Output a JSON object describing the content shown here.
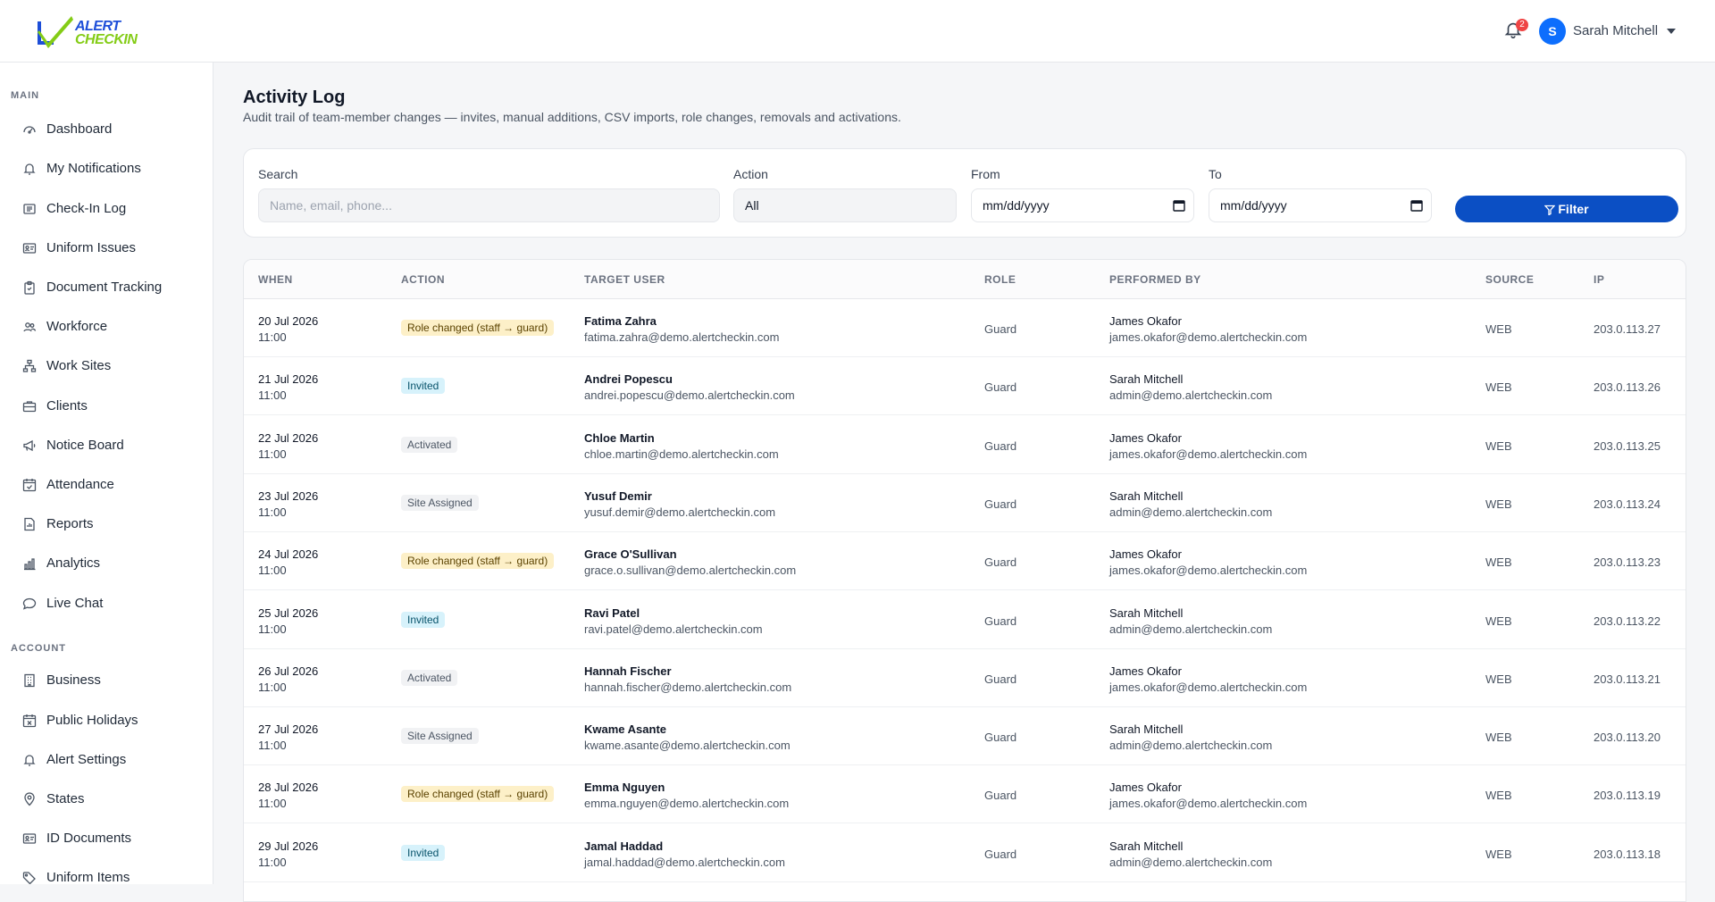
{
  "brand": {
    "line1": "ALERT",
    "line2": "CHECKIN",
    "blue": "#1d4ed8",
    "green": "#84cc16"
  },
  "header": {
    "notification_count": "2",
    "user_initial": "S",
    "user_name": "Sarah Mitchell",
    "accent": "#0d6efd"
  },
  "sidebar": {
    "sections": [
      {
        "title": "MAIN",
        "items": [
          {
            "label": "Dashboard",
            "icon": "dashboard-icon"
          },
          {
            "label": "My Notifications",
            "icon": "bell-icon"
          },
          {
            "label": "Check-In Log",
            "icon": "list-icon"
          },
          {
            "label": "Uniform Issues",
            "icon": "id-card-icon"
          },
          {
            "label": "Document Tracking",
            "icon": "clipboard-icon"
          },
          {
            "label": "Workforce",
            "icon": "people-icon"
          },
          {
            "label": "Work Sites",
            "icon": "sitemap-icon"
          },
          {
            "label": "Clients",
            "icon": "briefcase-icon"
          },
          {
            "label": "Notice Board",
            "icon": "megaphone-icon"
          },
          {
            "label": "Attendance",
            "icon": "calendar-check-icon"
          },
          {
            "label": "Reports",
            "icon": "report-icon"
          },
          {
            "label": "Analytics",
            "icon": "bar-chart-icon"
          },
          {
            "label": "Live Chat",
            "icon": "chat-icon"
          }
        ]
      },
      {
        "title": "ACCOUNT",
        "items": [
          {
            "label": "Business",
            "icon": "building-icon"
          },
          {
            "label": "Public Holidays",
            "icon": "calendar-x-icon"
          },
          {
            "label": "Alert Settings",
            "icon": "bell-icon"
          },
          {
            "label": "States",
            "icon": "map-pin-icon"
          },
          {
            "label": "ID Documents",
            "icon": "id-card-icon"
          },
          {
            "label": "Uniform Items",
            "icon": "tag-icon"
          }
        ]
      }
    ]
  },
  "page": {
    "title": "Activity Log",
    "subtitle": "Audit trail of team-member changes — invites, manual additions, CSV imports, role changes, removals and activations."
  },
  "filters": {
    "search_label": "Search",
    "search_placeholder": "Name, email, phone...",
    "action_label": "Action",
    "action_value": "All",
    "from_label": "From",
    "from_value": "mm/dd/yyyy",
    "to_label": "To",
    "to_value": "mm/dd/yyyy",
    "button_label": "Filter"
  },
  "table": {
    "columns": [
      "WHEN",
      "ACTION",
      "TARGET USER",
      "ROLE",
      "PERFORMED BY",
      "SOURCE",
      "IP"
    ],
    "rows": [
      {
        "date": "20 Jul 2026",
        "time": "11:00",
        "action": "Role changed (staff → guard)",
        "kind": "role",
        "name": "Fatima Zahra",
        "email": "fatima.zahra@demo.alertcheckin.com",
        "role": "Guard",
        "by_name": "James Okafor",
        "by_email": "james.okafor@demo.alertcheckin.com",
        "source": "WEB",
        "ip": "203.0.113.27"
      },
      {
        "date": "21 Jul 2026",
        "time": "11:00",
        "action": "Invited",
        "kind": "invited",
        "name": "Andrei Popescu",
        "email": "andrei.popescu@demo.alertcheckin.com",
        "role": "Guard",
        "by_name": "Sarah Mitchell",
        "by_email": "admin@demo.alertcheckin.com",
        "source": "WEB",
        "ip": "203.0.113.26"
      },
      {
        "date": "22 Jul 2026",
        "time": "11:00",
        "action": "Activated",
        "kind": "neutral",
        "name": "Chloe Martin",
        "email": "chloe.martin@demo.alertcheckin.com",
        "role": "Guard",
        "by_name": "James Okafor",
        "by_email": "james.okafor@demo.alertcheckin.com",
        "source": "WEB",
        "ip": "203.0.113.25"
      },
      {
        "date": "23 Jul 2026",
        "time": "11:00",
        "action": "Site Assigned",
        "kind": "neutral",
        "name": "Yusuf Demir",
        "email": "yusuf.demir@demo.alertcheckin.com",
        "role": "Guard",
        "by_name": "Sarah Mitchell",
        "by_email": "admin@demo.alertcheckin.com",
        "source": "WEB",
        "ip": "203.0.113.24"
      },
      {
        "date": "24 Jul 2026",
        "time": "11:00",
        "action": "Role changed (staff → guard)",
        "kind": "role",
        "name": "Grace O'Sullivan",
        "email": "grace.o.sullivan@demo.alertcheckin.com",
        "role": "Guard",
        "by_name": "James Okafor",
        "by_email": "james.okafor@demo.alertcheckin.com",
        "source": "WEB",
        "ip": "203.0.113.23"
      },
      {
        "date": "25 Jul 2026",
        "time": "11:00",
        "action": "Invited",
        "kind": "invited",
        "name": "Ravi Patel",
        "email": "ravi.patel@demo.alertcheckin.com",
        "role": "Guard",
        "by_name": "Sarah Mitchell",
        "by_email": "admin@demo.alertcheckin.com",
        "source": "WEB",
        "ip": "203.0.113.22"
      },
      {
        "date": "26 Jul 2026",
        "time": "11:00",
        "action": "Activated",
        "kind": "neutral",
        "name": "Hannah Fischer",
        "email": "hannah.fischer@demo.alertcheckin.com",
        "role": "Guard",
        "by_name": "James Okafor",
        "by_email": "james.okafor@demo.alertcheckin.com",
        "source": "WEB",
        "ip": "203.0.113.21"
      },
      {
        "date": "27 Jul 2026",
        "time": "11:00",
        "action": "Site Assigned",
        "kind": "neutral",
        "name": "Kwame Asante",
        "email": "kwame.asante@demo.alertcheckin.com",
        "role": "Guard",
        "by_name": "Sarah Mitchell",
        "by_email": "admin@demo.alertcheckin.com",
        "source": "WEB",
        "ip": "203.0.113.20"
      },
      {
        "date": "28 Jul 2026",
        "time": "11:00",
        "action": "Role changed (staff → guard)",
        "kind": "role",
        "name": "Emma Nguyen",
        "email": "emma.nguyen@demo.alertcheckin.com",
        "role": "Guard",
        "by_name": "James Okafor",
        "by_email": "james.okafor@demo.alertcheckin.com",
        "source": "WEB",
        "ip": "203.0.113.19"
      },
      {
        "date": "29 Jul 2026",
        "time": "11:00",
        "action": "Invited",
        "kind": "invited",
        "name": "Jamal Haddad",
        "email": "jamal.haddad@demo.alertcheckin.com",
        "role": "Guard",
        "by_name": "Sarah Mitchell",
        "by_email": "admin@demo.alertcheckin.com",
        "source": "WEB",
        "ip": "203.0.113.18"
      }
    ]
  }
}
